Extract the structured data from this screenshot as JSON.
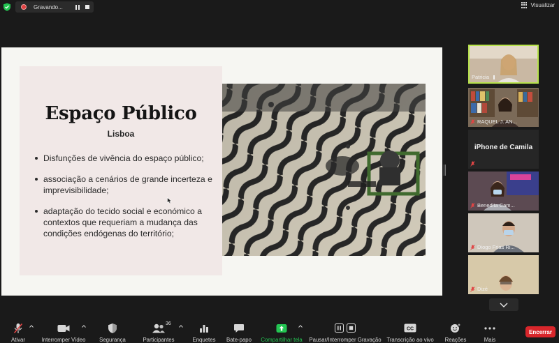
{
  "topbar": {
    "recording_text": "Gravando...",
    "view_label": "Visualizar"
  },
  "slide": {
    "title": "Espaço Público",
    "subtitle": "Lisboa",
    "bullets": [
      "Disfunções de vivência do espaço público;",
      "associação a cenários de grande incerteza e imprevisibilidade;",
      "adaptação do tecido social e económico a contextos que requeriam a mudança das condições endógenas do território;"
    ]
  },
  "participants": [
    {
      "name": "Patricia",
      "muted": false,
      "video": true,
      "active": true
    },
    {
      "name": "RAQUEL J. AN...",
      "muted": true,
      "video": true
    },
    {
      "name": "iPhone de Camila",
      "muted": true,
      "video": false
    },
    {
      "name": "Benedita Cam...",
      "muted": true,
      "video": true
    },
    {
      "name": "Diogo Frias Ri...",
      "muted": true,
      "video": true
    },
    {
      "name": "Dizé",
      "muted": true,
      "video": true
    }
  ],
  "toolbar": {
    "unmute": "Ativar",
    "stop_video": "Interromper Vídeo",
    "security": "Segurança",
    "participants": "Participantes",
    "participants_count": "36",
    "polls": "Enquetes",
    "chat": "Bate-papo",
    "share_screen": "Compartilhar tela",
    "pause_recording": "Pausar/Interromper Gravação",
    "live_transcript": "Transcrição ao vivo",
    "cc_label": "CC",
    "reactions": "Reações",
    "more": "Mais",
    "end": "Encerrar"
  },
  "colors": {
    "accent_green": "#23c552",
    "active_border": "#b7e24b",
    "end_red": "#d8262b",
    "muted_red": "#e04545",
    "slide_panel": "#f1e8e7"
  }
}
